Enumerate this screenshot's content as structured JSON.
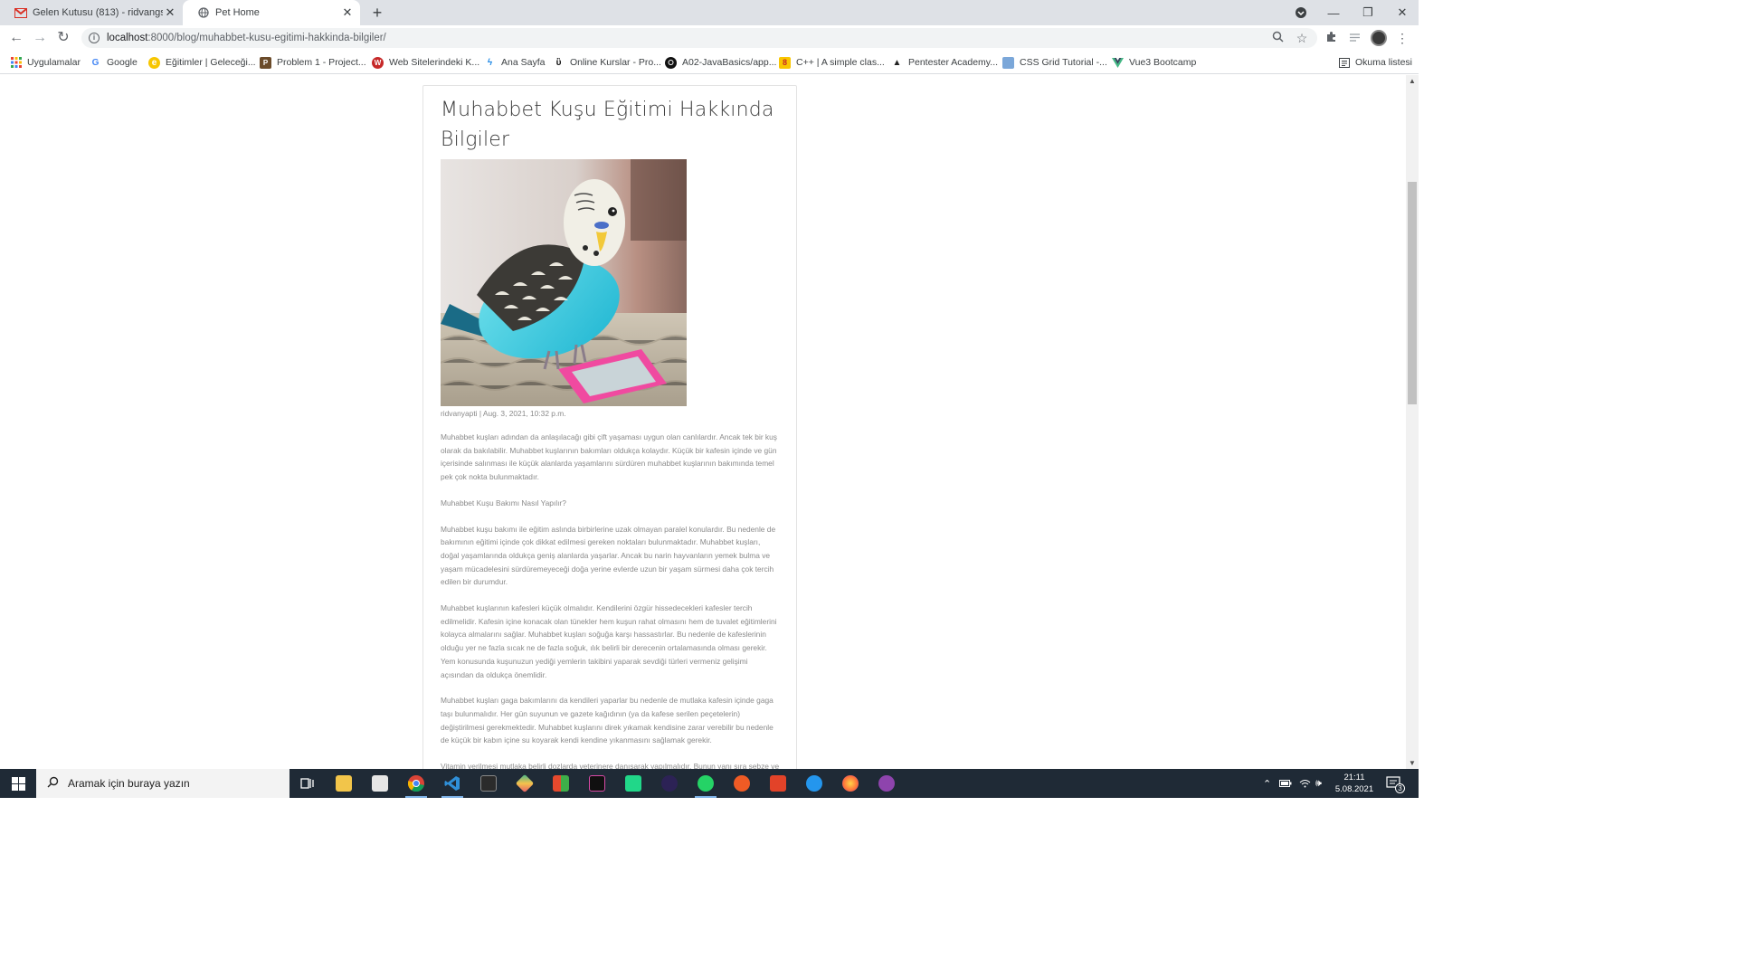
{
  "browser": {
    "tabs": [
      {
        "title": "Gelen Kutusu (813) - ridvangs77",
        "favicon": "gmail-icon"
      },
      {
        "title": "Pet Home",
        "favicon": "globe-icon"
      }
    ],
    "url_host": "localhost",
    "url_path": ":8000/blog/muhabbet-kusu-egitimi-hakkinda-bilgiler/",
    "bookmarks": [
      {
        "label": "Uygulamalar",
        "icon": "apps-grid-icon"
      },
      {
        "label": "Google",
        "icon": "google-icon"
      },
      {
        "label": "Eğitimler | Geleceği...",
        "icon": "bookmark-icon"
      },
      {
        "label": "Problem 1 - Project...",
        "icon": "bookmark-icon"
      },
      {
        "label": "Web Sitelerindeki K...",
        "icon": "bookmark-icon"
      },
      {
        "label": "Ana Sayfa",
        "icon": "bookmark-icon"
      },
      {
        "label": "Online Kurslar - Pro...",
        "icon": "bookmark-icon"
      },
      {
        "label": "A02-JavaBasics/app...",
        "icon": "github-icon"
      },
      {
        "label": "C++ | A simple clas...",
        "icon": "bookmark-icon"
      },
      {
        "label": "Pentester Academy...",
        "icon": "bookmark-icon"
      },
      {
        "label": "CSS Grid Tutorial -...",
        "icon": "bookmark-icon"
      },
      {
        "label": "Vue3 Bootcamp",
        "icon": "vue-icon"
      }
    ],
    "reading_list": "Okuma listesi"
  },
  "post": {
    "title": "Muhabbet Kuşu Eğitimi Hakkında Bilgiler",
    "image_alt": "budgie-photo",
    "meta": "ridvanyapti | Aug. 3, 2021, 10:32 p.m.",
    "paragraphs": [
      "Muhabbet kuşları adından da anlaşılacağı gibi çift yaşaması uygun olan canlılardır. Ancak tek bir kuş olarak da bakılabilir. Muhabbet kuşlarının bakımları oldukça kolaydır. Küçük bir kafesin içinde ve gün içerisinde salınması ile küçük alanlarda yaşamlarını sürdüren muhabbet kuşlarının bakımında temel pek çok nokta bulunmaktadır.",
      "Muhabbet Kuşu Bakımı Nasıl Yapılır?",
      "Muhabbet kuşu bakımı ile eğitim aslında birbirlerine uzak olmayan paralel konulardır. Bu nedenle de bakımının eğitimi içinde çok dikkat edilmesi gereken noktaları bulunmaktadır. Muhabbet kuşları, doğal yaşamlarında oldukça geniş alanlarda yaşarlar. Ancak bu narin hayvanların yemek bulma ve yaşam mücadelesini sürdüremeyeceği doğa yerine evlerde uzun bir yaşam sürmesi daha çok tercih edilen bir durumdur.",
      "Muhabbet kuşlarının kafesleri küçük olmalıdır. Kendilerini özgür hissedecekleri kafesler tercih edilmelidir. Kafesin içine konacak olan tünekler hem kuşun rahat olmasını hem de tuvalet eğitimlerini kolayca almalarını sağlar. Muhabbet kuşları soğuğa karşı hassastırlar. Bu nedenle de kafeslerinin olduğu yer ne fazla sıcak ne de fazla soğuk, ılık belirli bir derecenin ortalamasında olması gerekir. Yem konusunda kuşunuzun yediği yemlerin takibini yaparak sevdiği türleri vermeniz gelişimi açısından da oldukça önemlidir.",
      "Muhabbet kuşları gaga bakımlarını da kendileri yaparlar bu nedenle de mutlaka kafesin içinde gaga taşı bulunmalıdır. Her gün suyunun ve gazete kağıdının (ya da kafese serilen peçetelerin) değiştirilmesi gerekmektedir. Muhabbet kuşlarını direk yıkamak kendisine zarar verebilir bu nedenle de küçük bir kabın içine su koyarak kendi kendine yıkanmasını sağlamak gerekir.",
      "Vitamin verilmesi mutlaka belirli dozlarda veterinere danışarak yapılmalıdır. Bunun yanı sıra sebze ve meyvelerin verilmesinde herhangi bir sakınca yoktur. Muhabbet kuşlarının ev"
    ]
  },
  "taskbar": {
    "search_placeholder": "Aramak için buraya yazın",
    "time": "21:11",
    "date": "5.08.2021",
    "notification_count": "3",
    "apps": [
      {
        "name": "task-view",
        "color": "#ffffff"
      },
      {
        "name": "file-explorer",
        "color": "#f2c54a"
      },
      {
        "name": "store",
        "color": "#d9d9d9"
      },
      {
        "name": "chrome",
        "color": "#e0463a"
      },
      {
        "name": "vscode",
        "color": "#2f8fd8"
      },
      {
        "name": "terminal",
        "color": "#2b2b2b"
      },
      {
        "name": "git-kraken",
        "color": "#3fb68b"
      },
      {
        "name": "app-multicolor",
        "color": "#e6492d"
      },
      {
        "name": "intellij",
        "color": "#101010"
      },
      {
        "name": "pycharm",
        "color": "#21d789"
      },
      {
        "name": "eclipse",
        "color": "#2c2255"
      },
      {
        "name": "whatsapp",
        "color": "#25d366"
      },
      {
        "name": "postman",
        "color": "#ef5b25"
      },
      {
        "name": "git-gui",
        "color": "#e24329"
      },
      {
        "name": "docker",
        "color": "#2496ed"
      },
      {
        "name": "firefox",
        "color": "#ff7139"
      },
      {
        "name": "github-desktop",
        "color": "#8e44ad"
      }
    ]
  }
}
